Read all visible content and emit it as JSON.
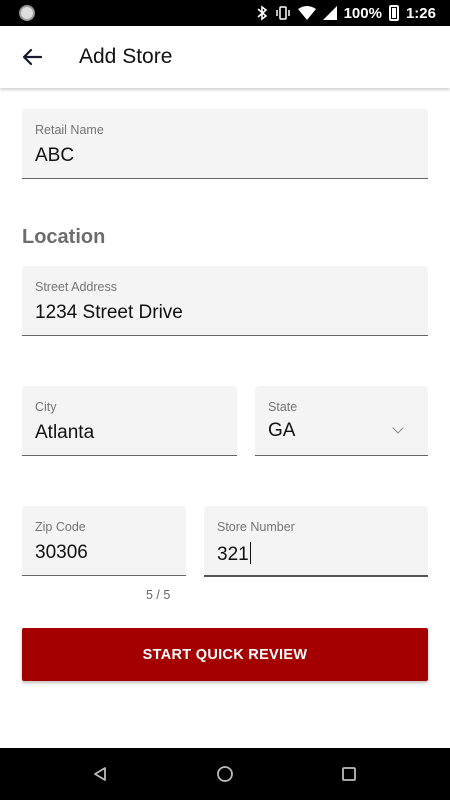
{
  "status_bar": {
    "battery_percent": "100%",
    "time": "1:26",
    "icons": [
      "bluetooth-icon",
      "vibrate-icon",
      "wifi-icon",
      "signal-icon",
      "battery-icon"
    ]
  },
  "app_bar": {
    "back_icon": "arrow-left-icon",
    "title": "Add Store"
  },
  "form": {
    "retail_name": {
      "label": "Retail Name",
      "value": "ABC"
    },
    "location_title": "Location",
    "street_address": {
      "label": "Street Address",
      "value": "1234 Street Drive"
    },
    "city": {
      "label": "City",
      "value": "Atlanta"
    },
    "state": {
      "label": "State",
      "value": "GA",
      "icon": "chevron-down-icon"
    },
    "zip_code": {
      "label": "Zip Code",
      "value": "30306",
      "counter": "5 / 5"
    },
    "store_number": {
      "label": "Store Number",
      "value": "321"
    },
    "submit_label": "START QUICK REVIEW"
  },
  "colors": {
    "primary_button": "#a50000",
    "field_background": "#f4f4f4",
    "section_title": "#6d6d6d"
  },
  "nav_bar": {
    "icons": [
      "back-triangle-icon",
      "home-circle-icon",
      "recents-square-icon"
    ]
  }
}
